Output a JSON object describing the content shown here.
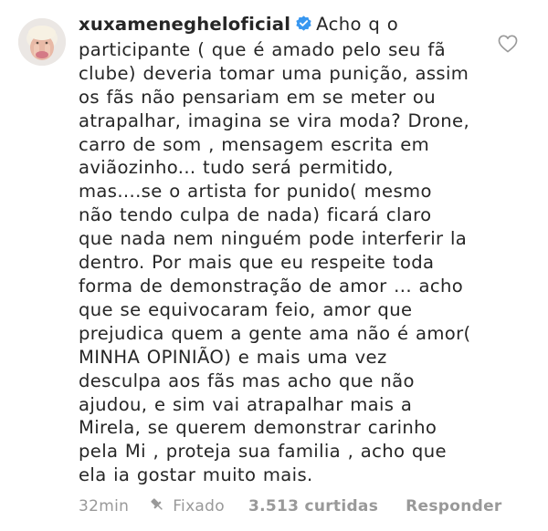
{
  "comment": {
    "username": "xuxamenegheloficial",
    "verified_icon": "verified-badge-icon",
    "text_lines": [
      "Acho q o",
      "participante ( que é amado pelo seu fã",
      "clube) deveria tomar uma punição, assim",
      "os fãs não pensariam em se meter ou",
      "atrapalhar, imagina se vira moda? Drone,",
      "carro de som , mensagem escrita em",
      "aviãozinho... tudo será permitido,",
      "mas....se o artista for punido( mesmo",
      "não tendo culpa de nada) ficará claro",
      "que nada nem ninguém pode interferir la",
      "dentro. Por mais que eu respeite toda",
      "forma de demonstração de amor ... acho",
      "que se equivocaram feio, amor que",
      "prejudica quem a gente ama não é amor(",
      "MINHA OPINIÃO) e mais uma vez",
      "desculpa aos fãs mas acho que não",
      "ajudou, e sim vai atrapalhar mais a",
      "Mirela, se querem demonstrar carinho",
      "pela Mi , proteja sua familia , acho que",
      "ela ia gostar muito mais."
    ],
    "like_icon": "heart-outline-icon",
    "meta": {
      "time": "32min",
      "pin_icon": "pin-icon",
      "pinned_label": "Fixado",
      "likes": "3.513 curtidas",
      "reply_label": "Responder"
    }
  },
  "colors": {
    "text": "#262626",
    "secondary": "#999999",
    "verified": "#3897f0"
  }
}
